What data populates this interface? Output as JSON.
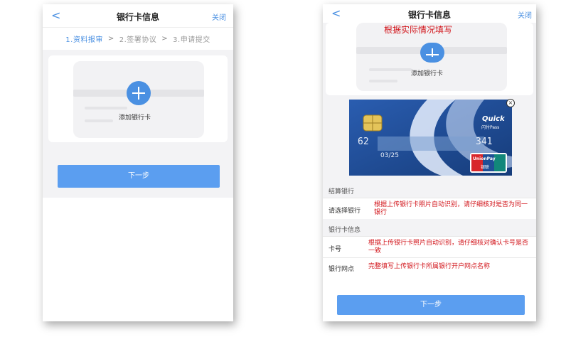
{
  "left": {
    "nav": {
      "back": "<",
      "title": "银行卡信息",
      "close": "关闭"
    },
    "steps": [
      "1.资料报审",
      "2.签署协议",
      "3.申请提交"
    ],
    "step_sep": ">",
    "add_card": "添加银行卡",
    "next": "下一步"
  },
  "right": {
    "nav": {
      "back": "<",
      "title": "银行卡信息",
      "close": "关闭"
    },
    "hint_top": "根据实际情况填写",
    "add_card": "添加银行卡",
    "card": {
      "number_start": "62",
      "number_end": "341",
      "expiry": "03/25",
      "quickpass": "Quick",
      "quickpass_sub": "闪付Pass",
      "unionpay": "UnionPay",
      "unionpay_cn": "银联"
    },
    "close_icon": "×",
    "settlement_section": "结算银行",
    "select_bank_label": "请选择银行",
    "select_bank_hint": "根据上传银行卡照片自动识别，请仔细核对是否为同一银行",
    "card_info_section": "银行卡信息",
    "card_no_label": "卡号",
    "card_no_hint": "根据上传银行卡照片自动识别，请仔细核对确认卡号是否一致",
    "branch_label": "银行网点",
    "branch_hint": "完整填写上传银行卡所属银行开户网点名称",
    "next": "下一步"
  },
  "colors": {
    "accent": "#4a90e2",
    "button": "#5b9ef0",
    "hint": "#d2151b",
    "card": "#1f4a8e"
  }
}
